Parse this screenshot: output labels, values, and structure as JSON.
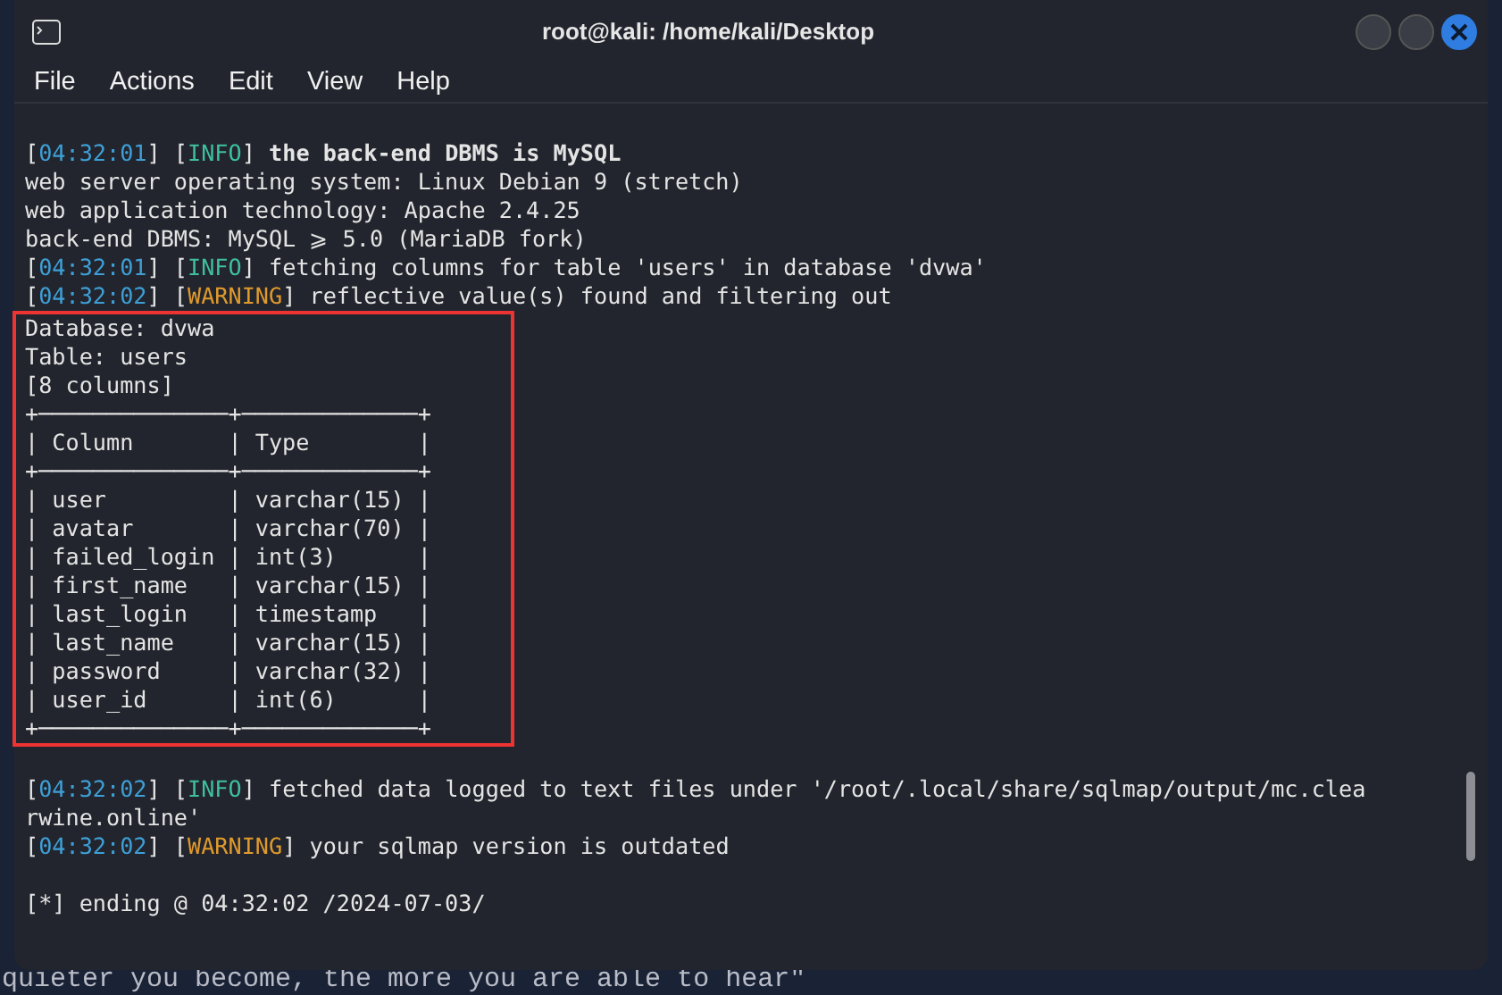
{
  "window": {
    "title": "root@kali: /home/kali/Desktop"
  },
  "menu": [
    "File",
    "Actions",
    "Edit",
    "View",
    "Help"
  ],
  "terminal": {
    "lines_before": [
      {
        "segments": [
          {
            "kind": "bracket",
            "text": "["
          },
          {
            "kind": "time",
            "text": "04:32:01"
          },
          {
            "kind": "bracket",
            "text": "] ["
          },
          {
            "kind": "info",
            "text": "INFO"
          },
          {
            "kind": "bracket",
            "text": "] "
          },
          {
            "kind": "bold",
            "text": "the back-end DBMS is MySQL"
          }
        ]
      },
      {
        "segments": [
          {
            "kind": "plain",
            "text": "web server operating system: Linux Debian 9 (stretch)"
          }
        ]
      },
      {
        "segments": [
          {
            "kind": "plain",
            "text": "web application technology: Apache 2.4.25"
          }
        ]
      },
      {
        "segments": [
          {
            "kind": "plain",
            "text": "back-end DBMS: MySQL ⩾ 5.0 (MariaDB fork)"
          }
        ]
      },
      {
        "segments": [
          {
            "kind": "bracket",
            "text": "["
          },
          {
            "kind": "time",
            "text": "04:32:01"
          },
          {
            "kind": "bracket",
            "text": "] ["
          },
          {
            "kind": "info",
            "text": "INFO"
          },
          {
            "kind": "bracket",
            "text": "] "
          },
          {
            "kind": "plain",
            "text": "fetching columns for table 'users' in database 'dvwa'"
          }
        ]
      },
      {
        "segments": [
          {
            "kind": "bracket",
            "text": "["
          },
          {
            "kind": "time",
            "text": "04:32:02"
          },
          {
            "kind": "bracket",
            "text": "] ["
          },
          {
            "kind": "warning",
            "text": "WARNING"
          },
          {
            "kind": "bracket",
            "text": "] "
          },
          {
            "kind": "plain",
            "text": "reflective value(s) found and filtering out"
          }
        ]
      }
    ],
    "highlighted_lines": [
      "Database: dvwa",
      "Table: users",
      "[8 columns]",
      "+──────────────+─────────────+",
      "| Column       | Type        |",
      "+──────────────+─────────────+",
      "| user         | varchar(15) |",
      "| avatar       | varchar(70) |",
      "| failed_login | int(3)      |",
      "| first_name   | varchar(15) |",
      "| last_login   | timestamp   |",
      "| last_name    | varchar(15) |",
      "| password     | varchar(32) |",
      "| user_id      | int(6)      |",
      "+──────────────+─────────────+"
    ],
    "lines_after": [
      {
        "kind": "blank"
      },
      {
        "segments": [
          {
            "kind": "bracket",
            "text": "["
          },
          {
            "kind": "time",
            "text": "04:32:02"
          },
          {
            "kind": "bracket",
            "text": "] ["
          },
          {
            "kind": "info",
            "text": "INFO"
          },
          {
            "kind": "bracket",
            "text": "] "
          },
          {
            "kind": "plain",
            "text": "fetched data logged to text files under '/root/.local/share/sqlmap/output/mc.clea"
          }
        ]
      },
      {
        "segments": [
          {
            "kind": "plain",
            "text": "rwine.online'"
          }
        ]
      },
      {
        "segments": [
          {
            "kind": "bracket",
            "text": "["
          },
          {
            "kind": "time",
            "text": "04:32:02"
          },
          {
            "kind": "bracket",
            "text": "] ["
          },
          {
            "kind": "warning",
            "text": "WARNING"
          },
          {
            "kind": "bracket",
            "text": "] "
          },
          {
            "kind": "plain",
            "text": "your sqlmap version is outdated"
          }
        ]
      },
      {
        "kind": "blank"
      },
      {
        "segments": [
          {
            "kind": "plain",
            "text": "[*] ending @ 04:32:02 /2024-07-03/"
          }
        ]
      }
    ]
  },
  "desktop_text": "quieter you become, the more you are able to hear\""
}
